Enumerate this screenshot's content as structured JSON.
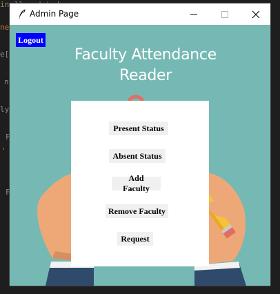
{
  "window": {
    "title": "Admin Page"
  },
  "toolbar": {
    "logout_label": "Logout"
  },
  "main": {
    "heading_line1": "Faculty Attendance",
    "heading_line2": "Reader"
  },
  "menu": {
    "items": [
      {
        "label": "Present Status"
      },
      {
        "label": "Absent Status"
      },
      {
        "label": "Add Faculty"
      },
      {
        "label": "Remove Faculty"
      },
      {
        "label": "Request"
      }
    ]
  },
  "colors": {
    "background_teal": "#76b9b4",
    "logout_blue": "#0000ff",
    "panel_white": "#ffffff",
    "button_gray": "#f0f0f0"
  },
  "icons": [
    "feather-icon",
    "minimize-icon",
    "maximize-icon",
    "close-icon"
  ]
}
